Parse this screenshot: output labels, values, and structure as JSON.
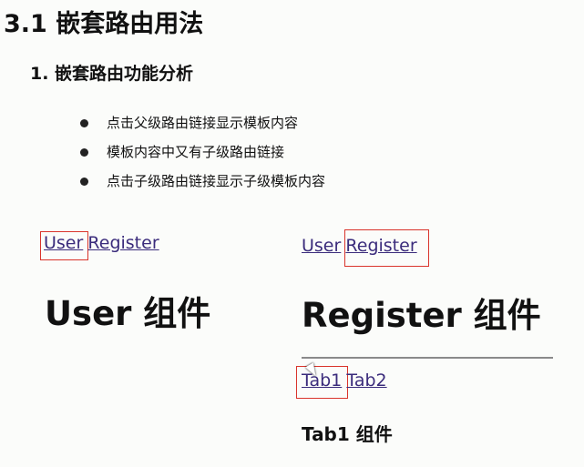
{
  "title": "3.1 嵌套路由用法",
  "subtitle": "1. 嵌套路由功能分析",
  "bullets": [
    "点击父级路由链接显示模板内容",
    "模板内容中又有子级路由链接",
    "点击子级路由链接显示子级模板内容"
  ],
  "left": {
    "links": [
      "User",
      "Register"
    ],
    "heading": "User 组件"
  },
  "right": {
    "links": [
      "User",
      "Register"
    ],
    "heading": "Register 组件",
    "tabs": [
      "Tab1",
      "Tab2"
    ],
    "tab_heading": "Tab1 组件"
  }
}
